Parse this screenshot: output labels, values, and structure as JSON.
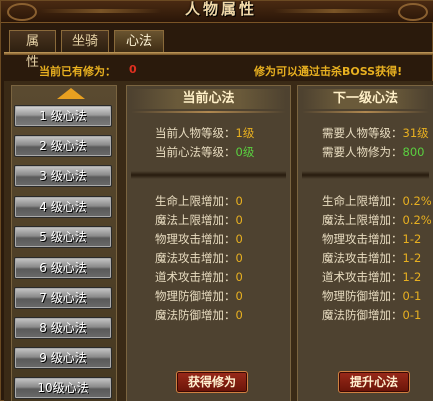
{
  "window": {
    "title": "人物属性"
  },
  "tabs": [
    {
      "label": "属 性"
    },
    {
      "label": "坐骑"
    },
    {
      "label": "心法"
    }
  ],
  "status": {
    "current_label": "当前已有修为：",
    "current_value": "0",
    "hint": "修为可以通过击杀BOSS获得!"
  },
  "levels": [
    {
      "label": "1 级心法"
    },
    {
      "label": "2 级心法"
    },
    {
      "label": "3 级心法"
    },
    {
      "label": "4 级心法"
    },
    {
      "label": "5 级心法"
    },
    {
      "label": "6 级心法"
    },
    {
      "label": "7 级心法"
    },
    {
      "label": "8 级心法"
    },
    {
      "label": "9 级心法"
    },
    {
      "label": "10级心法"
    }
  ],
  "current": {
    "title": "当前心法",
    "char_level_label": "当前人物等级：",
    "char_level_value": "1级",
    "method_level_label": "当前心法等级：",
    "method_level_value": "0级",
    "stats": [
      {
        "label": "生命上限增加：",
        "value": "0"
      },
      {
        "label": "魔法上限增加：",
        "value": "0"
      },
      {
        "label": "物理攻击增加：",
        "value": "0"
      },
      {
        "label": "魔法攻击增加：",
        "value": "0"
      },
      {
        "label": "道术攻击增加：",
        "value": "0"
      },
      {
        "label": "物理防御增加：",
        "value": "0"
      },
      {
        "label": "魔法防御增加：",
        "value": "0"
      }
    ],
    "button": "获得修为"
  },
  "next": {
    "title": "下一级心法",
    "need_level_label": "需要人物等级：",
    "need_level_value": "31级",
    "need_xiuwei_label": "需要人物修为：",
    "need_xiuwei_value": "800",
    "stats": [
      {
        "label": "生命上限增加：",
        "value": "0.2%"
      },
      {
        "label": "魔法上限增加：",
        "value": "0.2%"
      },
      {
        "label": "物理攻击增加：",
        "value": "1-2"
      },
      {
        "label": "魔法攻击增加：",
        "value": "1-2"
      },
      {
        "label": "道术攻击增加：",
        "value": "1-2"
      },
      {
        "label": "物理防御增加：",
        "value": "0-1"
      },
      {
        "label": "魔法防御增加：",
        "value": "0-1"
      }
    ],
    "button": "提升心法"
  },
  "colors": {
    "accent_gold": "#e8b020",
    "value_green": "#5ad040",
    "alert_red": "#e03020"
  }
}
